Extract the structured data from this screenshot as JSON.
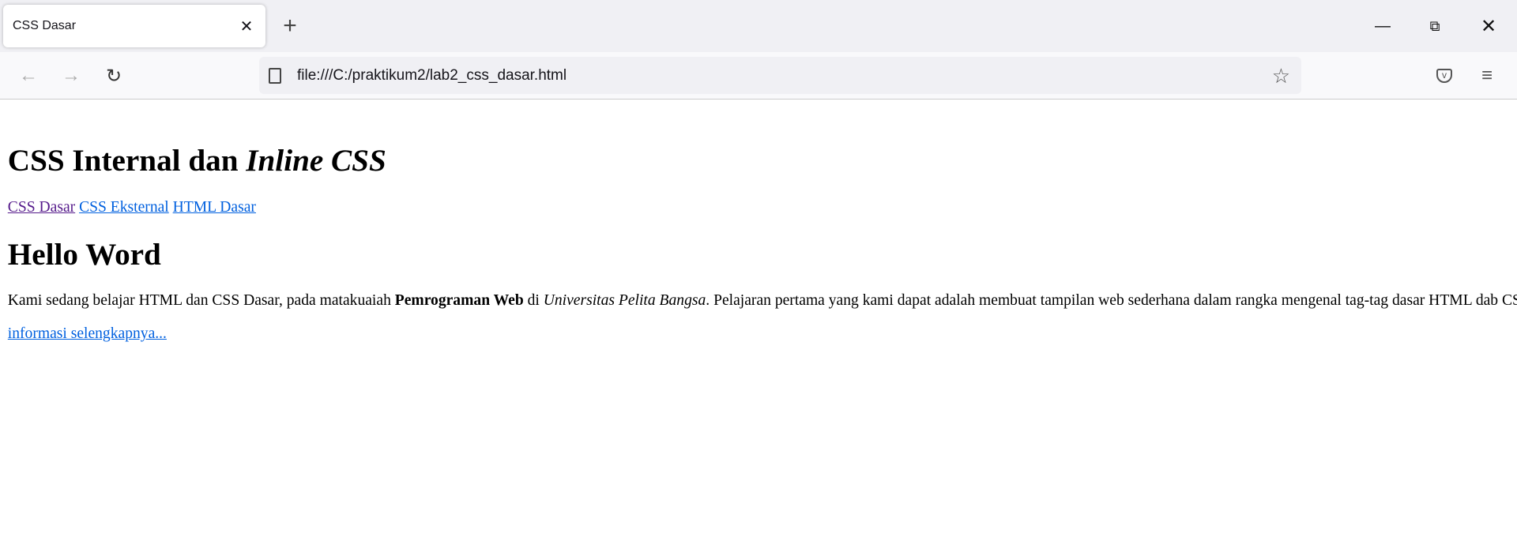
{
  "browser": {
    "tab_title": "CSS Dasar",
    "url": "file:///C:/praktikum2/lab2_css_dasar.html",
    "icons": [
      "close-icon",
      "plus-icon",
      "minimize-icon",
      "restore-icon",
      "window-close-icon",
      "back-icon",
      "forward-icon",
      "reload-icon",
      "document-icon",
      "star-icon",
      "pocket-icon",
      "menu-icon"
    ]
  },
  "page": {
    "heading_plain": "CSS Internal dan ",
    "heading_italic": "Inline CSS",
    "nav_links": [
      "CSS Dasar",
      "CSS Eksternal",
      "HTML Dasar"
    ],
    "title2": "Hello Word",
    "para": {
      "t1": "Kami sedang belajar HTML dan CSS Dasar, pada matakuaiah ",
      "bold": "Pemrograman Web",
      "t2": " di ",
      "italic": "Universitas Pelita Bangsa",
      "t3": ". Pelajaran pertama yang kami dapat adalah membuat tampilan web sederhana dalam rangka mengenal tag-tag dasar HTML dab CSS"
    },
    "more_link": "informasi selengkapnya..."
  },
  "colors": {
    "visited_link": "#551a8b",
    "link": "#0060df"
  }
}
